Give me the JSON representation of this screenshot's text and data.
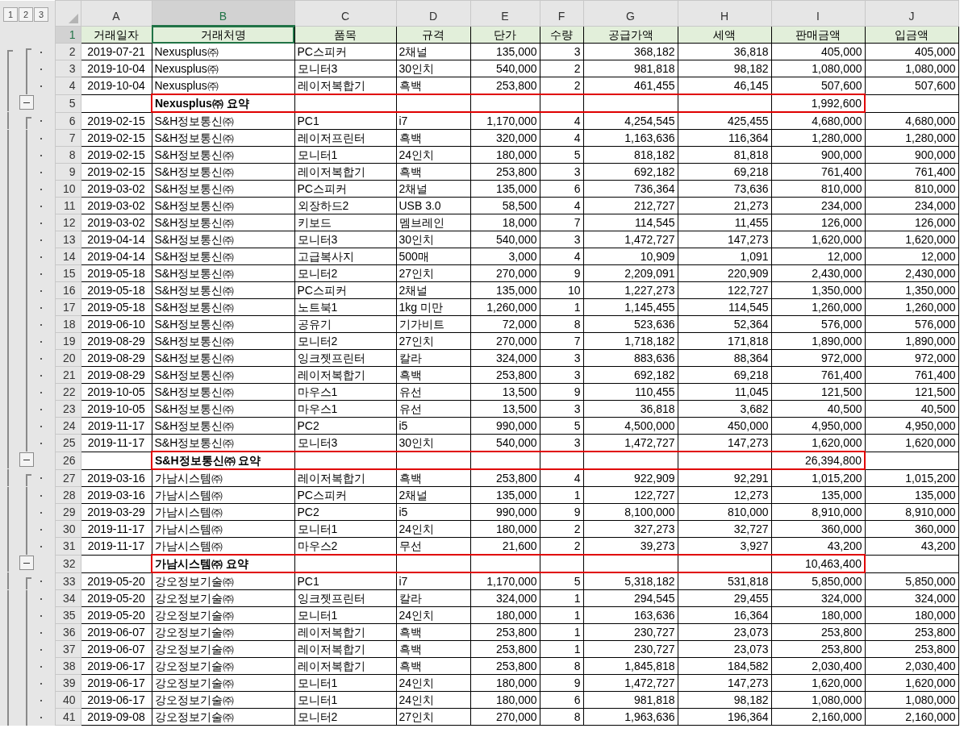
{
  "outline_levels": [
    "1",
    "2",
    "3"
  ],
  "columns": [
    {
      "letter": "A",
      "selected": false
    },
    {
      "letter": "B",
      "selected": true
    },
    {
      "letter": "C",
      "selected": false
    },
    {
      "letter": "D",
      "selected": false
    },
    {
      "letter": "E",
      "selected": false
    },
    {
      "letter": "F",
      "selected": false
    },
    {
      "letter": "G",
      "selected": false
    },
    {
      "letter": "H",
      "selected": false
    },
    {
      "letter": "I",
      "selected": false
    },
    {
      "letter": "J",
      "selected": false
    }
  ],
  "rows": [
    {
      "number": "1",
      "kind": "header",
      "selected": true,
      "cells": [
        "거래일자",
        "거래처명",
        "품목",
        "규격",
        "단가",
        "수량",
        "공급가액",
        "세액",
        "판매금액",
        "입금액"
      ]
    },
    {
      "number": "2",
      "kind": "data",
      "selected": false,
      "cells": [
        "2019-07-21",
        "Nexusplus㈜",
        "PC스피커",
        "2채널",
        "135,000",
        "3",
        "368,182",
        "36,818",
        "405,000",
        "405,000"
      ]
    },
    {
      "number": "3",
      "kind": "data",
      "selected": false,
      "cells": [
        "2019-10-04",
        "Nexusplus㈜",
        "모니터3",
        "30인치",
        "540,000",
        "2",
        "981,818",
        "98,182",
        "1,080,000",
        "1,080,000"
      ]
    },
    {
      "number": "4",
      "kind": "data",
      "selected": false,
      "cells": [
        "2019-10-04",
        "Nexusplus㈜",
        "레이저복합기",
        "흑백",
        "253,800",
        "2",
        "461,455",
        "46,145",
        "507,600",
        "507,600"
      ]
    },
    {
      "number": "5",
      "kind": "summary",
      "selected": false,
      "label": "Nexusplus㈜ 요약",
      "total": "1,992,600"
    },
    {
      "number": "6",
      "kind": "data",
      "selected": false,
      "cells": [
        "2019-02-15",
        "S&H정보통신㈜",
        "PC1",
        "i7",
        "1,170,000",
        "4",
        "4,254,545",
        "425,455",
        "4,680,000",
        "4,680,000"
      ]
    },
    {
      "number": "7",
      "kind": "data",
      "selected": false,
      "cells": [
        "2019-02-15",
        "S&H정보통신㈜",
        "레이저프린터",
        "흑백",
        "320,000",
        "4",
        "1,163,636",
        "116,364",
        "1,280,000",
        "1,280,000"
      ]
    },
    {
      "number": "8",
      "kind": "data",
      "selected": false,
      "cells": [
        "2019-02-15",
        "S&H정보통신㈜",
        "모니터1",
        "24인치",
        "180,000",
        "5",
        "818,182",
        "81,818",
        "900,000",
        "900,000"
      ]
    },
    {
      "number": "9",
      "kind": "data",
      "selected": false,
      "cells": [
        "2019-02-15",
        "S&H정보통신㈜",
        "레이저복합기",
        "흑백",
        "253,800",
        "3",
        "692,182",
        "69,218",
        "761,400",
        "761,400"
      ]
    },
    {
      "number": "10",
      "kind": "data",
      "selected": false,
      "cells": [
        "2019-03-02",
        "S&H정보통신㈜",
        "PC스피커",
        "2채널",
        "135,000",
        "6",
        "736,364",
        "73,636",
        "810,000",
        "810,000"
      ]
    },
    {
      "number": "11",
      "kind": "data",
      "selected": false,
      "cells": [
        "2019-03-02",
        "S&H정보통신㈜",
        "외장하드2",
        "USB 3.0",
        "58,500",
        "4",
        "212,727",
        "21,273",
        "234,000",
        "234,000"
      ]
    },
    {
      "number": "12",
      "kind": "data",
      "selected": false,
      "cells": [
        "2019-03-02",
        "S&H정보통신㈜",
        "키보드",
        "멤브레인",
        "18,000",
        "7",
        "114,545",
        "11,455",
        "126,000",
        "126,000"
      ]
    },
    {
      "number": "13",
      "kind": "data",
      "selected": false,
      "cells": [
        "2019-04-14",
        "S&H정보통신㈜",
        "모니터3",
        "30인치",
        "540,000",
        "3",
        "1,472,727",
        "147,273",
        "1,620,000",
        "1,620,000"
      ]
    },
    {
      "number": "14",
      "kind": "data",
      "selected": false,
      "cells": [
        "2019-04-14",
        "S&H정보통신㈜",
        "고급복사지",
        "500매",
        "3,000",
        "4",
        "10,909",
        "1,091",
        "12,000",
        "12,000"
      ]
    },
    {
      "number": "15",
      "kind": "data",
      "selected": false,
      "cells": [
        "2019-05-18",
        "S&H정보통신㈜",
        "모니터2",
        "27인치",
        "270,000",
        "9",
        "2,209,091",
        "220,909",
        "2,430,000",
        "2,430,000"
      ]
    },
    {
      "number": "16",
      "kind": "data",
      "selected": false,
      "cells": [
        "2019-05-18",
        "S&H정보통신㈜",
        "PC스피커",
        "2채널",
        "135,000",
        "10",
        "1,227,273",
        "122,727",
        "1,350,000",
        "1,350,000"
      ]
    },
    {
      "number": "17",
      "kind": "data",
      "selected": false,
      "cells": [
        "2019-05-18",
        "S&H정보통신㈜",
        "노트북1",
        "1kg 미만",
        "1,260,000",
        "1",
        "1,145,455",
        "114,545",
        "1,260,000",
        "1,260,000"
      ]
    },
    {
      "number": "18",
      "kind": "data",
      "selected": false,
      "cells": [
        "2019-06-10",
        "S&H정보통신㈜",
        "공유기",
        "기가비트",
        "72,000",
        "8",
        "523,636",
        "52,364",
        "576,000",
        "576,000"
      ]
    },
    {
      "number": "19",
      "kind": "data",
      "selected": false,
      "cells": [
        "2019-08-29",
        "S&H정보통신㈜",
        "모니터2",
        "27인치",
        "270,000",
        "7",
        "1,718,182",
        "171,818",
        "1,890,000",
        "1,890,000"
      ]
    },
    {
      "number": "20",
      "kind": "data",
      "selected": false,
      "cells": [
        "2019-08-29",
        "S&H정보통신㈜",
        "잉크젯프린터",
        "칼라",
        "324,000",
        "3",
        "883,636",
        "88,364",
        "972,000",
        "972,000"
      ]
    },
    {
      "number": "21",
      "kind": "data",
      "selected": false,
      "cells": [
        "2019-08-29",
        "S&H정보통신㈜",
        "레이저복합기",
        "흑백",
        "253,800",
        "3",
        "692,182",
        "69,218",
        "761,400",
        "761,400"
      ]
    },
    {
      "number": "22",
      "kind": "data",
      "selected": false,
      "cells": [
        "2019-10-05",
        "S&H정보통신㈜",
        "마우스1",
        "유선",
        "13,500",
        "9",
        "110,455",
        "11,045",
        "121,500",
        "121,500"
      ]
    },
    {
      "number": "23",
      "kind": "data",
      "selected": false,
      "cells": [
        "2019-10-05",
        "S&H정보통신㈜",
        "마우스1",
        "유선",
        "13,500",
        "3",
        "36,818",
        "3,682",
        "40,500",
        "40,500"
      ]
    },
    {
      "number": "24",
      "kind": "data",
      "selected": false,
      "cells": [
        "2019-11-17",
        "S&H정보통신㈜",
        "PC2",
        "i5",
        "990,000",
        "5",
        "4,500,000",
        "450,000",
        "4,950,000",
        "4,950,000"
      ]
    },
    {
      "number": "25",
      "kind": "data",
      "selected": false,
      "cells": [
        "2019-11-17",
        "S&H정보통신㈜",
        "모니터3",
        "30인치",
        "540,000",
        "3",
        "1,472,727",
        "147,273",
        "1,620,000",
        "1,620,000"
      ]
    },
    {
      "number": "26",
      "kind": "summary",
      "selected": false,
      "label": "S&H정보통신㈜ 요약",
      "total": "26,394,800"
    },
    {
      "number": "27",
      "kind": "data",
      "selected": false,
      "cells": [
        "2019-03-16",
        "가남시스템㈜",
        "레이저복합기",
        "흑백",
        "253,800",
        "4",
        "922,909",
        "92,291",
        "1,015,200",
        "1,015,200"
      ]
    },
    {
      "number": "28",
      "kind": "data",
      "selected": false,
      "cells": [
        "2019-03-16",
        "가남시스템㈜",
        "PC스피커",
        "2채널",
        "135,000",
        "1",
        "122,727",
        "12,273",
        "135,000",
        "135,000"
      ]
    },
    {
      "number": "29",
      "kind": "data",
      "selected": false,
      "cells": [
        "2019-03-29",
        "가남시스템㈜",
        "PC2",
        "i5",
        "990,000",
        "9",
        "8,100,000",
        "810,000",
        "8,910,000",
        "8,910,000"
      ]
    },
    {
      "number": "30",
      "kind": "data",
      "selected": false,
      "cells": [
        "2019-11-17",
        "가남시스템㈜",
        "모니터1",
        "24인치",
        "180,000",
        "2",
        "327,273",
        "32,727",
        "360,000",
        "360,000"
      ]
    },
    {
      "number": "31",
      "kind": "data",
      "selected": false,
      "cells": [
        "2019-11-17",
        "가남시스템㈜",
        "마우스2",
        "무선",
        "21,600",
        "2",
        "39,273",
        "3,927",
        "43,200",
        "43,200"
      ]
    },
    {
      "number": "32",
      "kind": "summary",
      "selected": false,
      "label": "가남시스템㈜ 요약",
      "total": "10,463,400"
    },
    {
      "number": "33",
      "kind": "data",
      "selected": false,
      "cells": [
        "2019-05-20",
        "강오정보기술㈜",
        "PC1",
        "i7",
        "1,170,000",
        "5",
        "5,318,182",
        "531,818",
        "5,850,000",
        "5,850,000"
      ]
    },
    {
      "number": "34",
      "kind": "data",
      "selected": false,
      "cells": [
        "2019-05-20",
        "강오정보기술㈜",
        "잉크젯프린터",
        "칼라",
        "324,000",
        "1",
        "294,545",
        "29,455",
        "324,000",
        "324,000"
      ]
    },
    {
      "number": "35",
      "kind": "data",
      "selected": false,
      "cells": [
        "2019-05-20",
        "강오정보기술㈜",
        "모니터1",
        "24인치",
        "180,000",
        "1",
        "163,636",
        "16,364",
        "180,000",
        "180,000"
      ]
    },
    {
      "number": "36",
      "kind": "data",
      "selected": false,
      "cells": [
        "2019-06-07",
        "강오정보기술㈜",
        "레이저복합기",
        "흑백",
        "253,800",
        "1",
        "230,727",
        "23,073",
        "253,800",
        "253,800"
      ]
    },
    {
      "number": "37",
      "kind": "data",
      "selected": false,
      "cells": [
        "2019-06-07",
        "강오정보기술㈜",
        "레이저복합기",
        "흑백",
        "253,800",
        "1",
        "230,727",
        "23,073",
        "253,800",
        "253,800"
      ]
    },
    {
      "number": "38",
      "kind": "data",
      "selected": false,
      "cells": [
        "2019-06-17",
        "강오정보기술㈜",
        "레이저복합기",
        "흑백",
        "253,800",
        "8",
        "1,845,818",
        "184,582",
        "2,030,400",
        "2,030,400"
      ]
    },
    {
      "number": "39",
      "kind": "data",
      "selected": false,
      "cells": [
        "2019-06-17",
        "강오정보기술㈜",
        "모니터1",
        "24인치",
        "180,000",
        "9",
        "1,472,727",
        "147,273",
        "1,620,000",
        "1,620,000"
      ]
    },
    {
      "number": "40",
      "kind": "data",
      "selected": false,
      "cells": [
        "2019-06-17",
        "강오정보기술㈜",
        "모니터1",
        "24인치",
        "180,000",
        "6",
        "981,818",
        "98,182",
        "1,080,000",
        "1,080,000"
      ]
    },
    {
      "number": "41",
      "kind": "data",
      "selected": false,
      "cells": [
        "2019-09-08",
        "강오정보기술㈜",
        "모니터2",
        "27인치",
        "270,000",
        "8",
        "1,963,636",
        "196,364",
        "2,160,000",
        "2,160,000"
      ]
    }
  ]
}
